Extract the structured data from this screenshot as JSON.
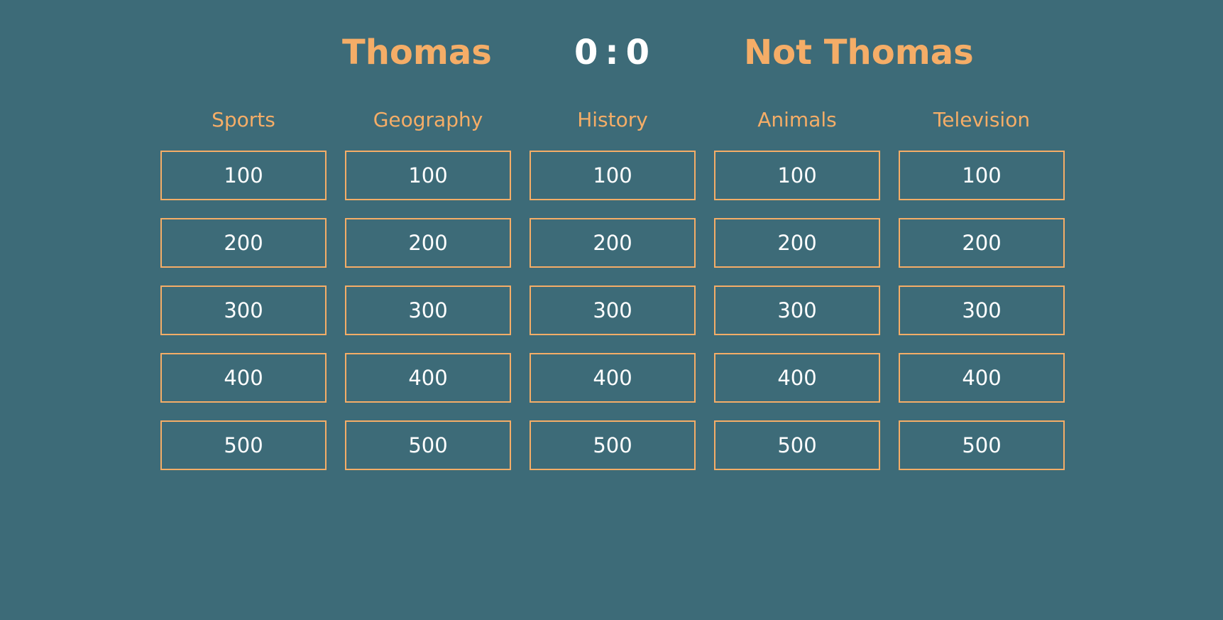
{
  "scoreboard": {
    "player_one": "Thomas",
    "player_one_score": "0",
    "separator": ":",
    "player_two_score": "0",
    "player_two": "Not Thomas"
  },
  "board": {
    "categories": [
      {
        "name": "Sports",
        "values": [
          "100",
          "200",
          "300",
          "400",
          "500"
        ]
      },
      {
        "name": "Geography",
        "values": [
          "100",
          "200",
          "300",
          "400",
          "500"
        ]
      },
      {
        "name": "History",
        "values": [
          "100",
          "200",
          "300",
          "400",
          "500"
        ]
      },
      {
        "name": "Animals",
        "values": [
          "100",
          "200",
          "300",
          "400",
          "500"
        ]
      },
      {
        "name": "Television",
        "values": [
          "100",
          "200",
          "300",
          "400",
          "500"
        ]
      }
    ]
  },
  "colors": {
    "background": "#3d6b78",
    "accent": "#f5ad67",
    "text": "#ffffff"
  }
}
